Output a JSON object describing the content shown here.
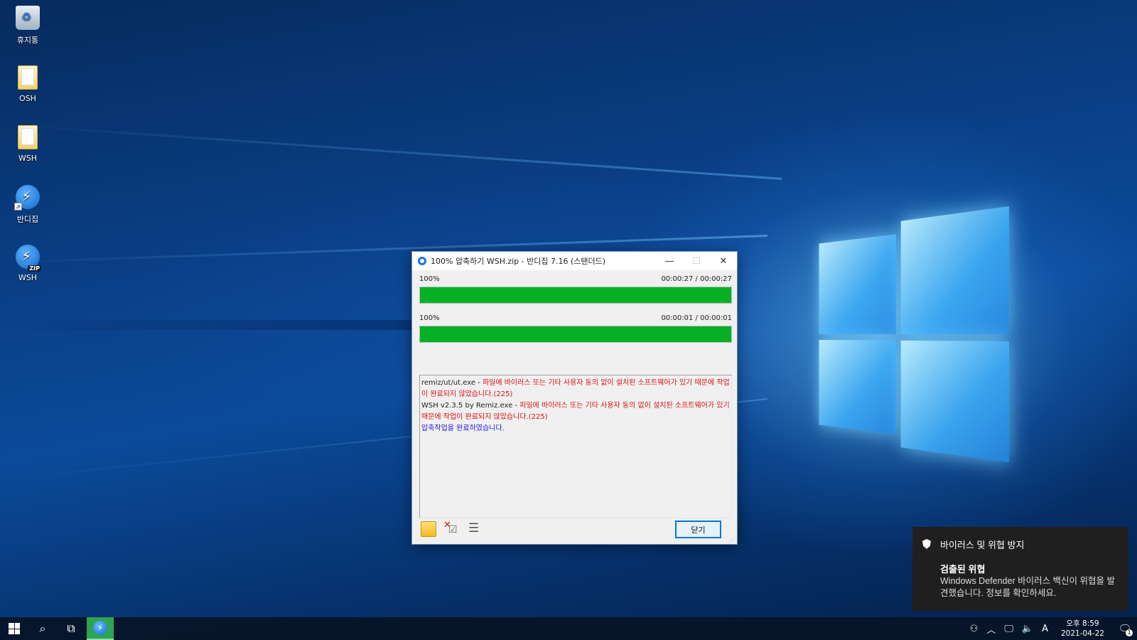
{
  "desktop": {
    "icons": [
      {
        "label": "휴지통",
        "icon": "recycle-bin-icon"
      },
      {
        "label": "OSH",
        "icon": "folder-icon"
      },
      {
        "label": "WSH",
        "icon": "folder-icon"
      },
      {
        "label": "반디집",
        "icon": "bandizip-shortcut-icon"
      },
      {
        "label": "WSH",
        "icon": "bandizip-zip-icon",
        "badge": "ZIP"
      }
    ]
  },
  "dialog": {
    "title": "100% 압축하기 WSH.zip - 반디집 7.16 (스탠더드)",
    "minimize_glyph": "—",
    "maximize_glyph": "☐",
    "close_glyph": "✕",
    "progress1": {
      "percent_label": "100%",
      "time": "00:00:27 / 00:00:27",
      "value": 1.0
    },
    "progress2": {
      "percent_label": "100%",
      "time": "00:00:01 / 00:00:01",
      "value": 1.0
    },
    "log": [
      {
        "file": "remiz/ut/ut.exe - ",
        "message": "파일에 바이러스 또는 기타 사용자 동의 없이 설치된 소프트웨어가 있기 때문에 작업이 완료되지 않았습니다.(225)"
      },
      {
        "file": "WSH v2.3.5 by Remiz.exe - ",
        "message": "파일에 바이러스 또는 기타 사용자 동의 없이 설치된 소프트웨어가 있기 때문에 작업이 완료되지 않았습니다.(225)"
      }
    ],
    "done_message": "압축작업을 완료하였습니다.",
    "close_button": "닫기",
    "colors": {
      "progress": "#06b025",
      "error": "#e01010",
      "done": "#1c1ce0",
      "focus": "#0078d7"
    }
  },
  "toast": {
    "app_name": "바이러스 및 위협 방지",
    "heading": "검출된 위협",
    "body": "Windows Defender 바이러스 백신이 위협을 발견했습니다. 정보를 확인하세요.",
    "icon": "shield-icon"
  },
  "taskbar": {
    "tray_ime": "A",
    "time": "오후 8:59",
    "date": "2021-04-22",
    "notification_count": "1"
  }
}
